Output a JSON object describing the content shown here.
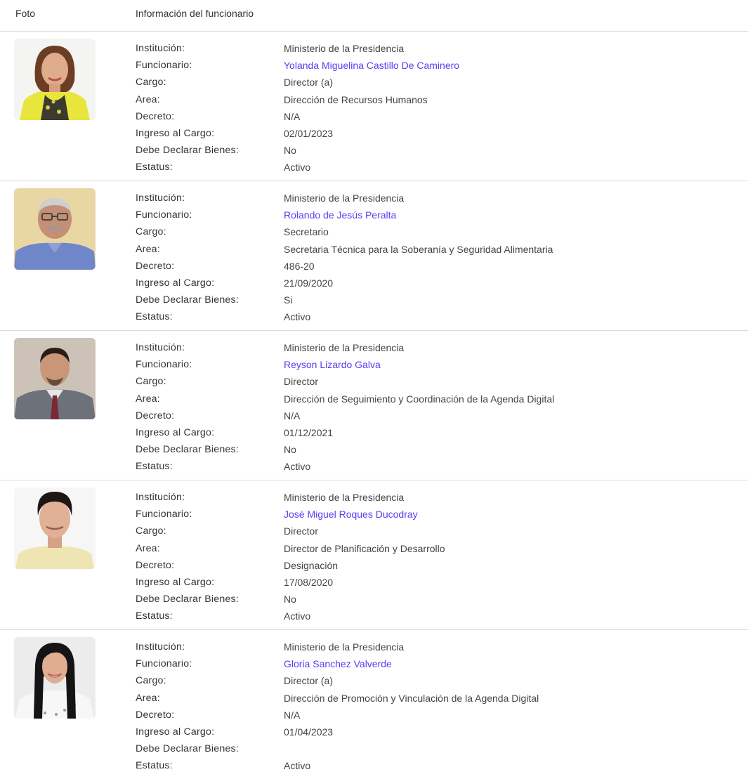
{
  "header": {
    "foto": "Foto",
    "info": "Información del funcionario"
  },
  "labels": {
    "institucion": "Institución:",
    "funcionario": "Funcionario:",
    "cargo": "Cargo:",
    "area": "Area:",
    "decreto": "Decreto:",
    "ingreso": "Ingreso al Cargo:",
    "declarar": "Debe Declarar Bienes:",
    "estatus": "Estatus:"
  },
  "colors": {
    "link": "#5b3cf3",
    "divider": "#d9d9d9"
  },
  "rows": [
    {
      "institucion": "Ministerio de la Presidencia",
      "funcionario": "Yolanda Miguelina Castillo De Caminero",
      "cargo": "Director (a)",
      "area": "Dirección de Recursos Humanos",
      "decreto": "N/A",
      "ingreso": "02/01/2023",
      "declarar": "No",
      "estatus": "Activo"
    },
    {
      "institucion": "Ministerio de la Presidencia",
      "funcionario": "Rolando de Jesús Peralta",
      "cargo": "Secretario",
      "area": "Secretaria Técnica para la Soberanía y Seguridad Alimentaria",
      "decreto": "486-20",
      "ingreso": "21/09/2020",
      "declarar": "Si",
      "estatus": "Activo"
    },
    {
      "institucion": "Ministerio de la Presidencia",
      "funcionario": "Reyson Lizardo Galva",
      "cargo": "Director",
      "area": "Dirección de Seguimiento y Coordinación de la Agenda Digital",
      "decreto": "N/A",
      "ingreso": "01/12/2021",
      "declarar": "No",
      "estatus": "Activo"
    },
    {
      "institucion": "Ministerio de la Presidencia",
      "funcionario": "José Miguel Roques Ducodray",
      "cargo": "Director",
      "area": "Director de Planificación y Desarrollo",
      "decreto": "Designación",
      "ingreso": "17/08/2020",
      "declarar": "No",
      "estatus": "Activo"
    },
    {
      "institucion": "Ministerio de la Presidencia",
      "funcionario": "Gloria Sanchez Valverde",
      "cargo": "Director (a)",
      "area": "Dirección de Promoción y Vinculación de la Agenda Digital",
      "decreto": "N/A",
      "ingreso": "01/04/2023",
      "declarar": "",
      "estatus": "Activo"
    }
  ]
}
